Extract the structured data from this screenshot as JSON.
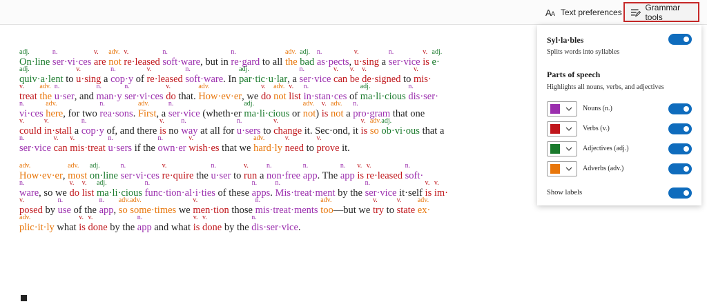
{
  "toolbar": {
    "text_prefs": "Text preferences",
    "grammar_tools": "Grammar tools"
  },
  "panel": {
    "syllables_title": "Syl·la·bles",
    "syllables_desc": "Splits words into syllables",
    "pos_title": "Parts of speech",
    "pos_desc": "Highlights all nouns, verbs, and adjectives",
    "nouns": "Nouns (n.)",
    "verbs": "Verbs (v.)",
    "adjectives": "Adjectives (adj.)",
    "adverbs": "Adverbs (adv.)",
    "show_labels": "Show labels",
    "colors": {
      "noun": "#9b2fae",
      "verb": "#c0161b",
      "adjective": "#1a7a2c",
      "adverb": "#e8760a",
      "toggle_on": "#0f6cbd"
    },
    "toggles": {
      "syllables": true,
      "nouns": true,
      "verbs": true,
      "adjectives": true,
      "adverbs": true,
      "show_labels": true
    }
  },
  "labels": {
    "n": "n.",
    "v": "v.",
    "adj": "adj.",
    "adv": "adv."
  },
  "paragraphs": [
    [
      [
        [
          "adj",
          "On·line"
        ],
        " ",
        [
          "n",
          "ser·vi·ces"
        ],
        " ",
        [
          "v",
          "are"
        ],
        " ",
        [
          "adv",
          "not"
        ],
        " ",
        [
          "v",
          "re·leased"
        ],
        " ",
        [
          "n",
          "soft·ware"
        ],
        ", but in ",
        [
          "n",
          "re·gard"
        ],
        " to all ",
        [
          "adv",
          "the"
        ],
        " ",
        [
          "adj",
          "bad"
        ],
        " ",
        [
          "n",
          "as·pects"
        ],
        ", ",
        [
          "v",
          "u·sing"
        ],
        " a ",
        [
          "n",
          "ser·vice"
        ],
        " ",
        [
          "v",
          "is"
        ],
        " ",
        [
          "adj",
          "e·"
        ]
      ],
      [
        [
          "adj",
          "quiv·a·lent"
        ],
        " to ",
        [
          "v",
          "u·sing"
        ],
        " a ",
        [
          "n",
          "cop·y"
        ],
        " of ",
        [
          "v",
          "re·leased"
        ],
        " ",
        [
          "n",
          "soft·ware"
        ],
        ". In ",
        [
          "adj",
          "par·tic·u·lar"
        ],
        ", a ",
        [
          "n",
          "ser·vice"
        ],
        " ",
        [
          "v",
          "can"
        ],
        " ",
        [
          "v",
          "be"
        ],
        " ",
        [
          "v",
          "de·signed"
        ],
        " to ",
        [
          "v",
          "mis·"
        ]
      ],
      [
        [
          "v",
          "treat"
        ],
        " ",
        [
          "adv",
          "the"
        ],
        " ",
        [
          "n",
          "u·ser"
        ],
        ", and ",
        [
          "n",
          "man·y"
        ],
        " ",
        [
          "n",
          "ser·vi·ces"
        ],
        " ",
        [
          "v",
          "do"
        ],
        " that. ",
        [
          "adv",
          "How·ev·er"
        ],
        ", we ",
        [
          "v",
          "do"
        ],
        " ",
        [
          "adv",
          "not"
        ],
        " ",
        [
          "v",
          "list"
        ],
        " ",
        [
          "n",
          "in·stan·ces"
        ],
        " of ",
        [
          "adj",
          "ma·li·cious"
        ],
        " ",
        [
          "n",
          "dis·ser·"
        ]
      ],
      [
        [
          "n",
          "vi·ces"
        ],
        " ",
        [
          "adv",
          "here"
        ],
        ", for two ",
        [
          "n",
          "rea·sons"
        ],
        ". ",
        [
          "adv",
          "First"
        ],
        ", a ",
        [
          "n",
          "ser·vice"
        ],
        " (wheth·er ",
        [
          "adj",
          "ma·li·cious"
        ],
        " or ",
        [
          "adv",
          "not"
        ],
        ") ",
        [
          "v",
          "is"
        ],
        " ",
        [
          "adv",
          "not"
        ],
        " a ",
        [
          "n",
          "pro·gram"
        ],
        " that one"
      ],
      [
        [
          "v",
          "could"
        ],
        " ",
        [
          "v",
          "in·stall"
        ],
        " a ",
        [
          "n",
          "cop·y"
        ],
        " of, and there ",
        [
          "v",
          "is"
        ],
        " no ",
        [
          "n",
          "way"
        ],
        " at all for ",
        [
          "n",
          "u·sers"
        ],
        " to ",
        [
          "v",
          "change"
        ],
        " it. Sec·ond, it ",
        [
          "v",
          "is"
        ],
        " ",
        [
          "adv",
          "so"
        ],
        " ",
        [
          "adj",
          "ob·vi·ous"
        ],
        " that a"
      ],
      [
        [
          "n",
          "ser·vice"
        ],
        " ",
        [
          "v",
          "can"
        ],
        " ",
        [
          "v",
          "mis·treat"
        ],
        " ",
        [
          "n",
          "u·sers"
        ],
        " if the ",
        [
          "n",
          "own·er"
        ],
        " ",
        [
          "v",
          "wish·es"
        ],
        " that we ",
        [
          "adv",
          "hard·ly"
        ],
        " ",
        [
          "v",
          "need"
        ],
        " to ",
        [
          "v",
          "prove"
        ],
        " it."
      ]
    ],
    [
      [
        [
          "adv",
          "How·ev·er"
        ],
        ", ",
        [
          "adv",
          "most"
        ],
        " ",
        [
          "adj",
          "on·line"
        ],
        " ",
        [
          "n",
          "ser·vi·ces"
        ],
        " ",
        [
          "v",
          "re·quire"
        ],
        " the ",
        [
          "n",
          "u·ser"
        ],
        " to ",
        [
          "v",
          "run"
        ],
        " a ",
        [
          "n",
          "non·free"
        ],
        " ",
        [
          "n",
          "app"
        ],
        ". The ",
        [
          "n",
          "app"
        ],
        " ",
        [
          "v",
          "is"
        ],
        " ",
        [
          "v",
          "re·leased"
        ],
        " ",
        [
          "n",
          "soft·"
        ]
      ],
      [
        [
          "n",
          "ware"
        ],
        ", so we ",
        [
          "v",
          "do"
        ],
        " ",
        [
          "v",
          "list"
        ],
        " ",
        [
          "adj",
          "ma·li·cious"
        ],
        " ",
        [
          "n",
          "func·tion·al·i·ties"
        ],
        " of these ",
        [
          "n",
          "apps"
        ],
        ". ",
        [
          "n",
          "Mis·treat·ment"
        ],
        " by the ",
        [
          "n",
          "ser·vice"
        ],
        " it·self ",
        [
          "v",
          "is"
        ],
        " ",
        [
          "v",
          "im·"
        ]
      ],
      [
        [
          "v",
          "posed"
        ],
        " by ",
        [
          "n",
          "use"
        ],
        " of the ",
        [
          "n",
          "app"
        ],
        ", ",
        [
          "adv",
          "so"
        ],
        " ",
        [
          "adv",
          "some·times"
        ],
        " we ",
        [
          "v",
          "men·tion"
        ],
        " those ",
        [
          "n",
          "mis·treat·ments"
        ],
        " ",
        [
          "adv",
          "too"
        ],
        "—but we ",
        [
          "v",
          "try"
        ],
        " to ",
        [
          "v",
          "state"
        ],
        " ",
        [
          "adv",
          "ex·"
        ]
      ],
      [
        [
          "adv",
          "plic·it·ly"
        ],
        " what ",
        [
          "v",
          "is"
        ],
        " ",
        [
          "v",
          "done"
        ],
        " by the ",
        [
          "n",
          "app"
        ],
        " and what ",
        [
          "v",
          "is"
        ],
        " ",
        [
          "v",
          "done"
        ],
        " by the ",
        [
          "n",
          "dis·ser·vice"
        ],
        "."
      ]
    ]
  ]
}
